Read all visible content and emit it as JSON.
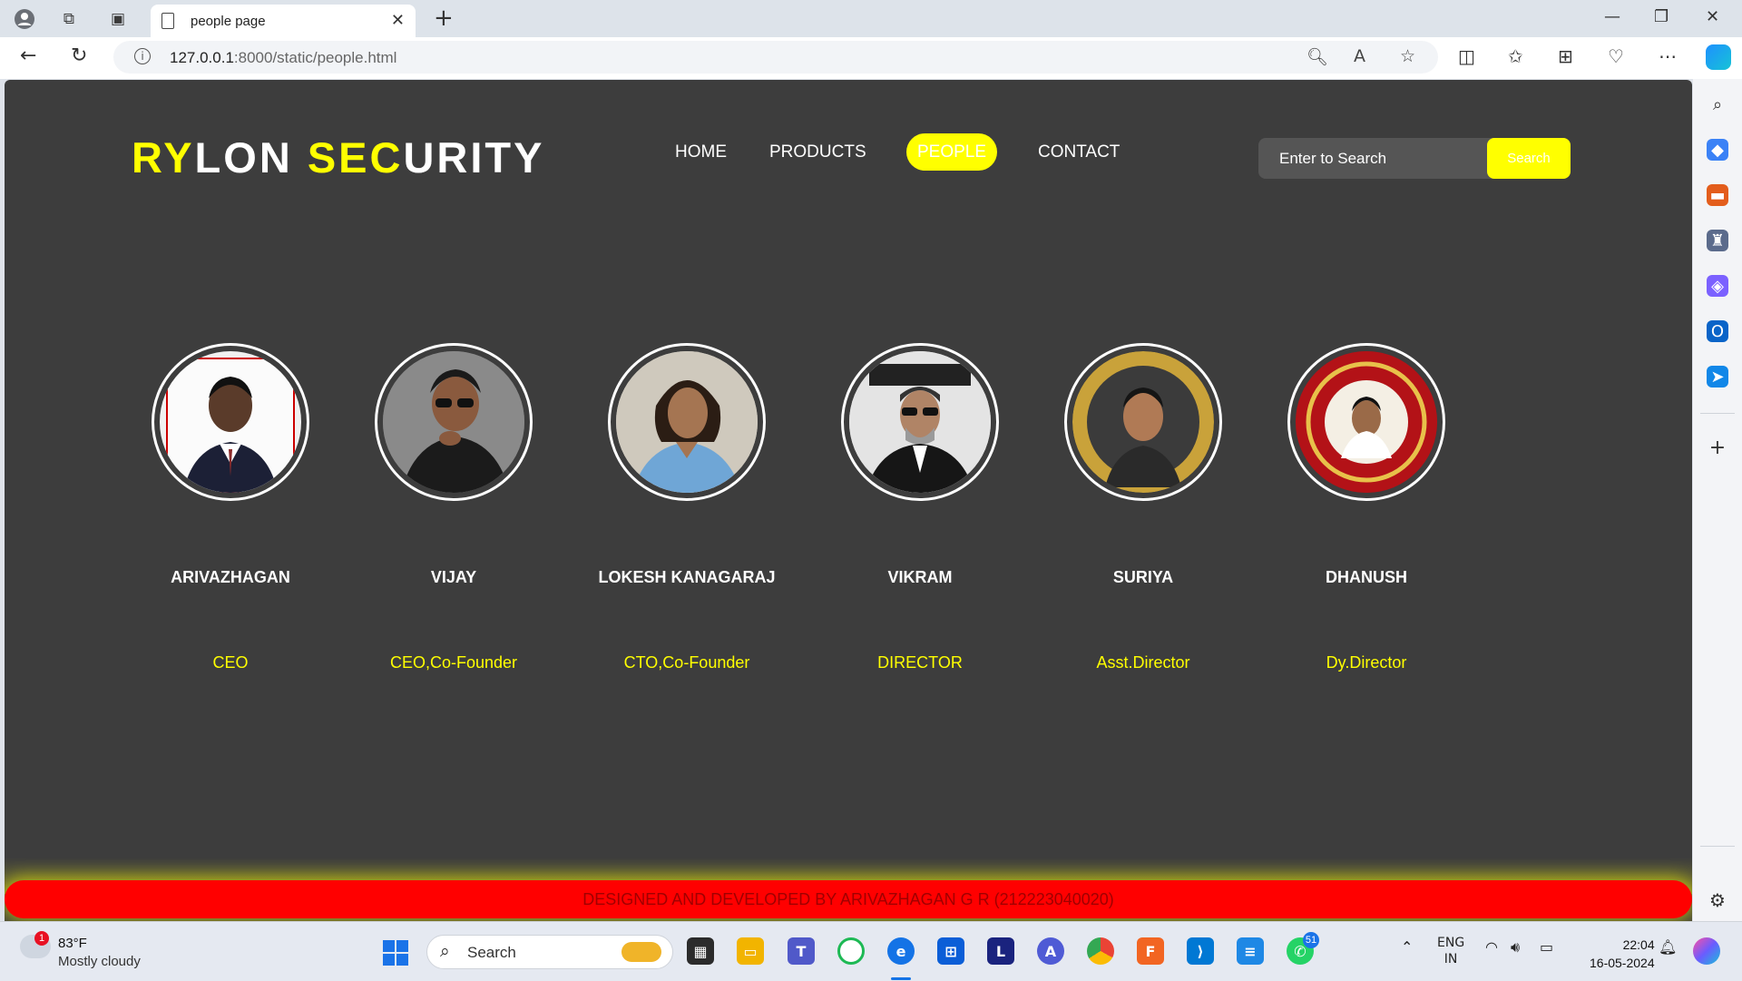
{
  "browser": {
    "tab_title": "people page",
    "url_host": "127.0.0.1",
    "url_path": ":8000/static/people.html"
  },
  "site": {
    "logo_parts": [
      "RY",
      "LON",
      " SEC",
      "U",
      "RITY"
    ],
    "nav": [
      "HOME",
      "PRODUCTS",
      "PEOPLE",
      "CONTACT"
    ],
    "search_placeholder": "Enter to Search",
    "search_button": "Search",
    "people": [
      {
        "name": "ARIVAZHAGAN",
        "role": "CEO"
      },
      {
        "name": "VIJAY",
        "role": "CEO,Co-Founder"
      },
      {
        "name": "LOKESH KANAGARAJ",
        "role": "CTO,Co-Founder"
      },
      {
        "name": "VIKRAM",
        "role": "DIRECTOR"
      },
      {
        "name": "SURIYA",
        "role": "Asst.Director"
      },
      {
        "name": "DHANUSH",
        "role": "Dy.Director"
      }
    ],
    "footer": "DESIGNED AND DEVELOPED BY ARIVAZHAGAN G R (212223040020)",
    "colors": {
      "background": "#3d3d3d",
      "accent": "#ffff00",
      "footer": "#ff0000"
    }
  },
  "taskbar": {
    "weather_temp": "83°F",
    "weather_desc": "Mostly cloudy",
    "weather_badge": "1",
    "search_label": "Search",
    "teams_badge": "51",
    "lang_line1": "ENG",
    "lang_line2": "IN",
    "time": "22:04",
    "date": "16-05-2024"
  }
}
